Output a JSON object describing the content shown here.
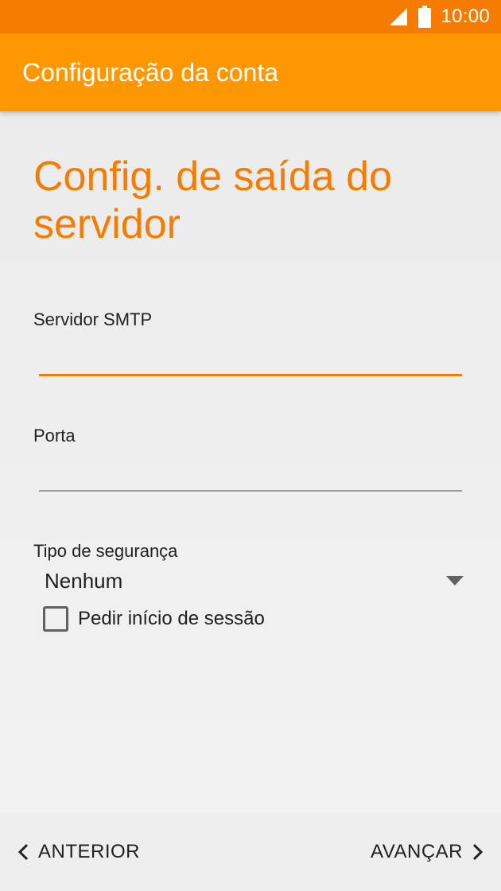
{
  "status_bar": {
    "time": "10:00"
  },
  "app_bar": {
    "title": "Configuração da conta"
  },
  "page": {
    "heading": "Config. de saída do servidor"
  },
  "form": {
    "smtp_label": "Servidor SMTP",
    "smtp_value": "",
    "port_label": "Porta",
    "port_value": "",
    "security_label": "Tipo de segurança",
    "security_value": "Nenhum",
    "login_checkbox_label": "Pedir início de sessão",
    "login_checked": false
  },
  "nav": {
    "back_label": "ANTERIOR",
    "next_label": "AVANÇAR"
  },
  "colors": {
    "status_bar": "#f57c00",
    "app_bar": "#ff9800",
    "accent": "#f57c00"
  }
}
